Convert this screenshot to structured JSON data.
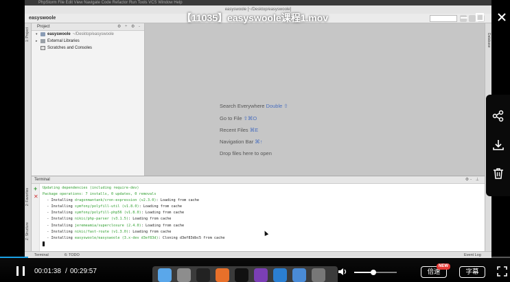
{
  "video": {
    "title": "【11035】easyswoole课程1.mov",
    "time_current": "00:01:38",
    "time_separator": "/",
    "time_total": "00:29:57",
    "progress_fraction": 0.055,
    "volume_fraction": 0.45,
    "speed_label": "倍速",
    "speed_badge": "NEW",
    "subtitle_label": "字幕",
    "accent_color": "#1aa3e8"
  },
  "ide": {
    "menubar": "PhpStorm   File   Edit   View   Navigate   Code   Refactor   Run   Tools   VCS   Window   Help",
    "window_title": "easyswoole [~/Desktop/easyswoole]",
    "nav_crumb": "easyswoole",
    "left_tabs": [
      "1: Project",
      "2: Favorites",
      "Z: Structure"
    ],
    "right_tabs": [
      "Database"
    ],
    "project": {
      "header": "Project",
      "tools": "⚙ ÷ ⚙ -",
      "items": [
        {
          "label": "easyswoole",
          "path": "~/Desktop/easyswoole"
        },
        {
          "label": "External Libraries",
          "path": ""
        },
        {
          "label": "Scratches and Consoles",
          "path": ""
        }
      ]
    },
    "editor_hints": [
      {
        "text": "Search Everywhere ",
        "key": "Double ⇧"
      },
      {
        "text": "Go to File ",
        "key": "⇧⌘O"
      },
      {
        "text": "Recent Files ",
        "key": "⌘E"
      },
      {
        "text": "Navigation Bar ",
        "key": "⌘↑"
      },
      {
        "text": "Drop files here to open",
        "key": ""
      }
    ],
    "terminal": {
      "header": "Terminal",
      "tools": "⚙- ⊥",
      "lines": [
        {
          "text": "Updating dependencies (including require-dev)",
          "green": true
        },
        {
          "text": "Package operations: 7 installs, 0 updates, 0 removals",
          "green": true
        },
        {
          "pre": "  - Installing ",
          "pkg": "dragonmantank/cron-expression",
          "ver": " (v2.3.0)",
          "post": ": Loading from cache"
        },
        {
          "pre": "  - Installing ",
          "pkg": "symfony/polyfill-util",
          "ver": " (v1.8.0)",
          "post": ": Loading from cache"
        },
        {
          "pre": "  - Installing ",
          "pkg": "symfony/polyfill-php56",
          "ver": " (v1.8.0)",
          "post": ": Loading from cache"
        },
        {
          "pre": "  - Installing ",
          "pkg": "nikic/php-parser",
          "ver": " (v3.1.5)",
          "post": ": Loading from cache"
        },
        {
          "pre": "  - Installing ",
          "pkg": "jeremeamia/superclosure",
          "ver": " (2.4.0)",
          "post": ": Loading from cache"
        },
        {
          "pre": "  - Installing ",
          "pkg": "nikic/fast-route",
          "ver": " (v1.3.0)",
          "post": ": Loading from cache"
        },
        {
          "pre": "  - Installing ",
          "pkg": "easyswoole/easyswoole",
          "ver": " (3.x-dev d3ef83d)",
          "post": ": Cloning d3ef83dbc5 from cache"
        }
      ]
    },
    "statusbar": {
      "terminal_tab": "Terminal",
      "todo_tab": "6: TODO",
      "event_log": "Event Log"
    }
  }
}
